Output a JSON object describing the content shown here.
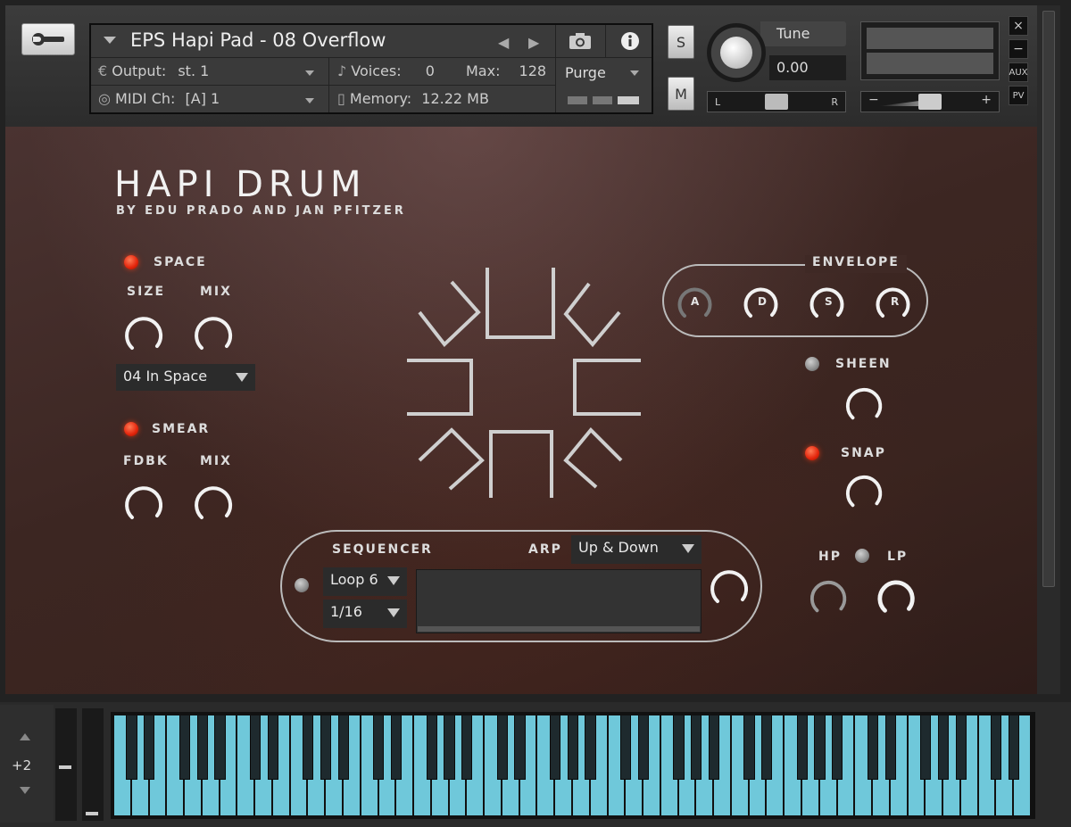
{
  "header": {
    "instrument_name": "EPS Hapi Pad - 08 Overflow",
    "output_label": "Output:",
    "output_value": "st. 1",
    "voices_label": "Voices:",
    "voices_value": "0",
    "max_label": "Max:",
    "max_value": "128",
    "purge_label": "Purge",
    "midi_label": "MIDI Ch:",
    "midi_value": "[A]  1",
    "memory_label": "Memory:",
    "memory_value": "12.22 MB",
    "solo_label": "S",
    "mute_label": "M",
    "tune_label": "Tune",
    "tune_value": "0.00",
    "pan_left": "L",
    "pan_right": "R",
    "vol_minus": "−",
    "vol_plus": "+",
    "close_label": "×",
    "minimize_label": "−",
    "aux_label": "AUX",
    "pv_label": "PV"
  },
  "instrument": {
    "title": "HAPI DRUM",
    "subtitle": "BY EDU PRADO AND JAN PFITZER",
    "space": {
      "label": "SPACE",
      "enabled": true,
      "size_label": "SIZE",
      "mix_label": "MIX",
      "preset": "04 In Space"
    },
    "smear": {
      "label": "SMEAR",
      "enabled": true,
      "fdbk_label": "FDBK",
      "mix_label": "MIX"
    },
    "envelope": {
      "label": "ENVELOPE",
      "a": "A",
      "d": "D",
      "s": "S",
      "r": "R"
    },
    "sheen": {
      "label": "SHEEN",
      "enabled": false
    },
    "snap": {
      "label": "SNAP",
      "enabled": true
    },
    "filter": {
      "hp_label": "HP",
      "lp_label": "LP"
    },
    "sequencer": {
      "label": "SEQUENCER",
      "arp_label": "ARP",
      "arp_mode": "Up & Down",
      "pattern": "Loop 6",
      "rate": "1/16",
      "enabled": false
    }
  },
  "keyboard": {
    "octave_shift": "+2",
    "key_color": "#6fc8da"
  },
  "colors": {
    "led_on": "#e3240b",
    "led_off": "#8c8c8c",
    "panel_bg": "#3c2622"
  }
}
